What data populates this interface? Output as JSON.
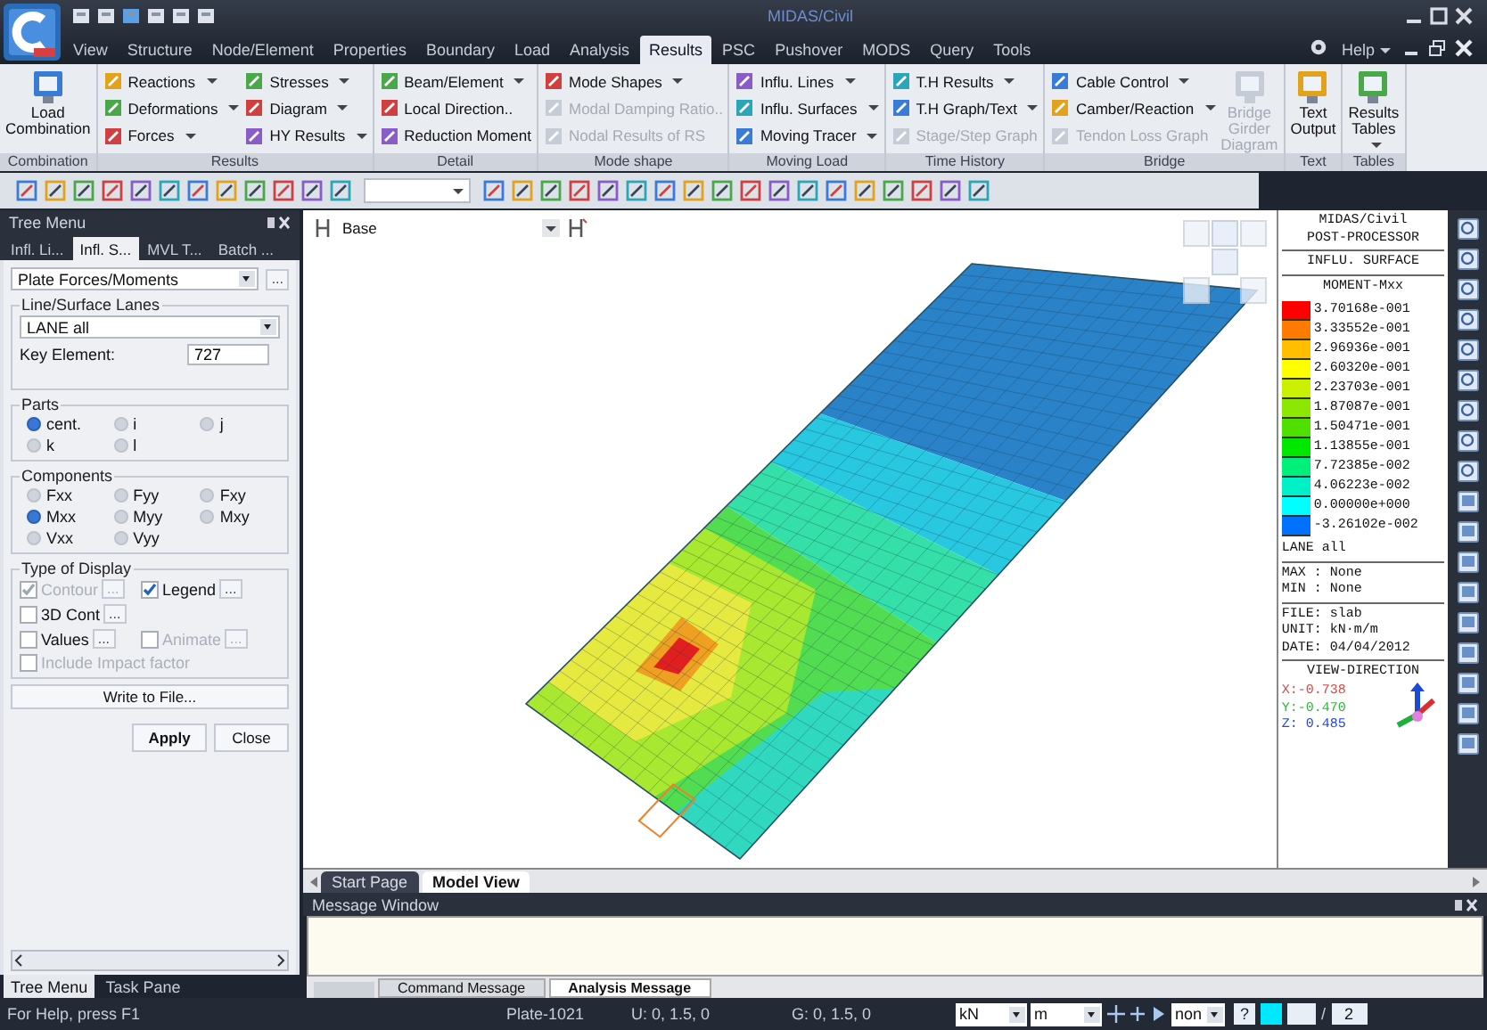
{
  "window": {
    "title": "MIDAS/Civil"
  },
  "menu_tabs": [
    {
      "label": "View",
      "selected": false
    },
    {
      "label": "Structure",
      "selected": false
    },
    {
      "label": "Node/Element",
      "selected": false
    },
    {
      "label": "Properties",
      "selected": false
    },
    {
      "label": "Boundary",
      "selected": false
    },
    {
      "label": "Load",
      "selected": false
    },
    {
      "label": "Analysis",
      "selected": false
    },
    {
      "label": "Results",
      "selected": true
    },
    {
      "label": "PSC",
      "selected": false
    },
    {
      "label": "Pushover",
      "selected": false
    },
    {
      "label": "MODS",
      "selected": false
    },
    {
      "label": "Query",
      "selected": false
    },
    {
      "label": "Tools",
      "selected": false
    }
  ],
  "help": {
    "label": "Help"
  },
  "ribbon": [
    {
      "label": "Combination",
      "columns": [
        {
          "kind": "large",
          "items": [
            {
              "label": "Load Combination",
              "disabled": false,
              "dropdown": false
            }
          ]
        }
      ]
    },
    {
      "label": "Results",
      "columns": [
        {
          "kind": "stack",
          "items": [
            {
              "label": "Reactions",
              "disabled": false,
              "dropdown": true
            },
            {
              "label": "Deformations",
              "disabled": false,
              "dropdown": true
            },
            {
              "label": "Forces",
              "disabled": false,
              "dropdown": true
            }
          ]
        },
        {
          "kind": "stack",
          "items": [
            {
              "label": "Stresses",
              "disabled": false,
              "dropdown": true
            },
            {
              "label": "Diagram",
              "disabled": false,
              "dropdown": true
            },
            {
              "label": "HY Results",
              "disabled": false,
              "dropdown": true
            }
          ]
        }
      ]
    },
    {
      "label": "Detail",
      "columns": [
        {
          "kind": "stack",
          "items": [
            {
              "label": "Beam/Element",
              "disabled": false,
              "dropdown": true
            },
            {
              "label": "Local Direction..",
              "disabled": false,
              "dropdown": false
            },
            {
              "label": "Reduction Moment",
              "disabled": false,
              "dropdown": false
            }
          ]
        }
      ]
    },
    {
      "label": "Mode shape",
      "columns": [
        {
          "kind": "stack",
          "items": [
            {
              "label": "Mode Shapes",
              "disabled": false,
              "dropdown": true
            },
            {
              "label": "Modal Damping Ratio..",
              "disabled": true,
              "dropdown": false
            },
            {
              "label": "Nodal Results of RS",
              "disabled": true,
              "dropdown": false
            }
          ]
        }
      ]
    },
    {
      "label": "Moving Load",
      "columns": [
        {
          "kind": "stack",
          "items": [
            {
              "label": "Influ. Lines",
              "disabled": false,
              "dropdown": true
            },
            {
              "label": "Influ. Surfaces",
              "disabled": false,
              "dropdown": true
            },
            {
              "label": "Moving Tracer",
              "disabled": false,
              "dropdown": true
            }
          ]
        }
      ]
    },
    {
      "label": "Time History",
      "columns": [
        {
          "kind": "stack",
          "items": [
            {
              "label": "T.H Results",
              "disabled": false,
              "dropdown": true
            },
            {
              "label": "T.H Graph/Text",
              "disabled": false,
              "dropdown": true
            },
            {
              "label": "Stage/Step Graph",
              "disabled": true,
              "dropdown": false
            }
          ]
        }
      ]
    },
    {
      "label": "Bridge",
      "columns": [
        {
          "kind": "stack",
          "items": [
            {
              "label": "Cable Control",
              "disabled": false,
              "dropdown": true
            },
            {
              "label": "Camber/Reaction",
              "disabled": false,
              "dropdown": true
            },
            {
              "label": "Tendon Loss Graph",
              "disabled": true,
              "dropdown": false
            }
          ]
        },
        {
          "kind": "large",
          "items": [
            {
              "label": "Bridge Girder Diagram",
              "disabled": true,
              "dropdown": false
            }
          ]
        }
      ]
    },
    {
      "label": "Text",
      "columns": [
        {
          "kind": "large",
          "items": [
            {
              "label": "Text Output",
              "disabled": false,
              "dropdown": false
            }
          ]
        }
      ]
    },
    {
      "label": "Tables",
      "columns": [
        {
          "kind": "large",
          "items": [
            {
              "label": "Results Tables",
              "disabled": false,
              "dropdown": true
            }
          ]
        }
      ]
    }
  ],
  "tree_menu": {
    "title": "Tree Menu",
    "tabs": [
      {
        "label": "Infl. Li...",
        "selected": false
      },
      {
        "label": "Infl. S...",
        "selected": true
      },
      {
        "label": "MVL T...",
        "selected": false
      },
      {
        "label": "Batch ...",
        "selected": false
      }
    ],
    "result_type": {
      "value": "Plate Forces/Moments",
      "button": "..."
    },
    "lanes": {
      "title": "Line/Surface Lanes",
      "value": "LANE all",
      "key_label": "Key Element:",
      "key_value": "727"
    },
    "parts": {
      "title": "Parts",
      "options": [
        {
          "label": "cent.",
          "selected": true
        },
        {
          "label": "i",
          "selected": false
        },
        {
          "label": "j",
          "selected": false
        },
        {
          "label": "k",
          "selected": false
        },
        {
          "label": "l",
          "selected": false
        }
      ]
    },
    "components": {
      "title": "Components",
      "options": [
        {
          "label": "Fxx",
          "selected": false
        },
        {
          "label": "Fyy",
          "selected": false
        },
        {
          "label": "Fxy",
          "selected": false
        },
        {
          "label": "Mxx",
          "selected": true
        },
        {
          "label": "Myy",
          "selected": false
        },
        {
          "label": "Mxy",
          "selected": false
        },
        {
          "label": "Vxx",
          "selected": false
        },
        {
          "label": "Vyy",
          "selected": false
        }
      ]
    },
    "display": {
      "title": "Type of Display",
      "rows": [
        [
          {
            "label": "Contour",
            "checked": true,
            "disabled": true,
            "button": "..."
          },
          {
            "label": "Legend",
            "checked": true,
            "disabled": false,
            "button": "..."
          }
        ],
        [
          {
            "label": "3D Cont",
            "checked": false,
            "disabled": false,
            "button": "..."
          }
        ],
        [
          {
            "label": "Values",
            "checked": false,
            "disabled": false,
            "button": "..."
          },
          {
            "label": "Animate",
            "checked": false,
            "disabled": true,
            "button": "..."
          }
        ],
        [
          {
            "label": "Include Impact factor",
            "checked": false,
            "disabled": true
          }
        ]
      ]
    },
    "write_button": "Write to File...",
    "apply_button": "Apply",
    "close_button": "Close",
    "bottom_tabs": [
      {
        "label": "Tree Menu",
        "selected": true
      },
      {
        "label": "Task Pane",
        "selected": false
      }
    ]
  },
  "view": {
    "layer": "Base",
    "tabs": [
      {
        "label": "Start Page",
        "selected": false
      },
      {
        "label": "Model View",
        "selected": true
      }
    ]
  },
  "legend": {
    "header": "MIDAS/Civil",
    "subheader": "POST-PROCESSOR",
    "type": "INFLU. SURFACE",
    "component": "MOMENT-Mxx",
    "levels": [
      {
        "value": "3.70168e-001",
        "color": "#ff0000"
      },
      {
        "value": "3.33552e-001",
        "color": "#ff7a00"
      },
      {
        "value": "2.96936e-001",
        "color": "#ffbf00"
      },
      {
        "value": "2.60320e-001",
        "color": "#ffff00"
      },
      {
        "value": "2.23703e-001",
        "color": "#c8f000"
      },
      {
        "value": "1.87087e-001",
        "color": "#8ce800"
      },
      {
        "value": "1.50471e-001",
        "color": "#50e000"
      },
      {
        "value": "1.13855e-001",
        "color": "#00e800"
      },
      {
        "value": "7.72385e-002",
        "color": "#00f07a"
      },
      {
        "value": "4.06223e-002",
        "color": "#00f0c8"
      },
      {
        "value": "0.00000e+000",
        "color": "#00ffff"
      },
      {
        "value": "-3.26102e-002",
        "color": "#0070ff"
      }
    ],
    "lane": "LANE all",
    "max": "MAX : None",
    "min": "MIN : None",
    "file": "FILE: slab",
    "unit": "UNIT: kN·m/m",
    "date": "DATE: 04/04/2012",
    "view_direction": "VIEW-DIRECTION",
    "x": "X:-0.738",
    "y": "Y:-0.470",
    "z": "Z: 0.485"
  },
  "message": {
    "title": "Message Window",
    "tabs": [
      {
        "label": "Command Message",
        "selected": false
      },
      {
        "label": "Analysis Message",
        "selected": true
      }
    ]
  },
  "status_bar": {
    "help": "For Help, press F1",
    "element": "Plate-1021",
    "u": "U: 0, 1.5, 0",
    "g": "G: 0, 1.5, 0",
    "force_unit": "kN",
    "length_unit": "m",
    "snap": "non",
    "help_button": "?",
    "separator": "/",
    "page": "2"
  }
}
